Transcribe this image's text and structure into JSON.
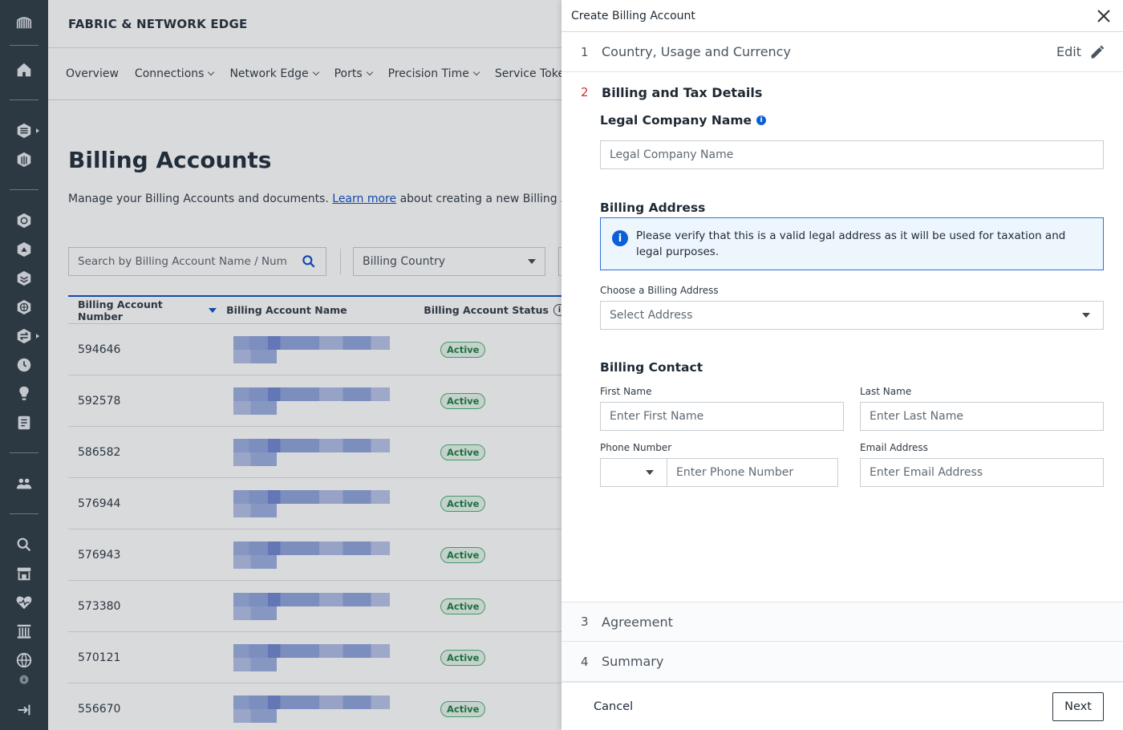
{
  "app": {
    "brand": "FABRIC & NETWORK EDGE"
  },
  "rail_icons": [
    "equinix-logo-icon",
    "home-icon",
    "layers-icon",
    "cube-icon",
    "network-icon",
    "share-icon",
    "stack-icon",
    "globe-icon",
    "exchange-icon",
    "clock-icon",
    "lightbulb-icon",
    "document-icon",
    "users-icon",
    "search-icon",
    "store-icon",
    "heartbeat-icon",
    "pillars-icon",
    "world-icon",
    "download-icon",
    "logout-icon"
  ],
  "nav": {
    "items": [
      {
        "label": "Overview",
        "has_menu": false
      },
      {
        "label": "Connections",
        "has_menu": true
      },
      {
        "label": "Network Edge",
        "has_menu": true
      },
      {
        "label": "Ports",
        "has_menu": true
      },
      {
        "label": "Precision Time",
        "has_menu": true
      },
      {
        "label": "Service Tokens",
        "has_menu": false
      }
    ]
  },
  "page": {
    "title": "Billing Accounts",
    "subtitle_before": "Manage your Billing Accounts and documents.",
    "subtitle_link": "Learn more",
    "subtitle_after": "about creating a new Billing Account.",
    "search_placeholder": "Search by Billing Account Name / Number",
    "country_filter": "Billing Country"
  },
  "table": {
    "columns": [
      "Billing Account Number",
      "Billing Account Name",
      "Billing Account Status"
    ],
    "rows": [
      {
        "number": "594646",
        "status": "Active"
      },
      {
        "number": "592578",
        "status": "Active"
      },
      {
        "number": "586582",
        "status": "Active"
      },
      {
        "number": "576944",
        "status": "Active"
      },
      {
        "number": "576943",
        "status": "Active"
      },
      {
        "number": "573380",
        "status": "Active"
      },
      {
        "number": "570121",
        "status": "Active"
      },
      {
        "number": "556670",
        "status": "Active"
      }
    ]
  },
  "drawer": {
    "title": "Create Billing Account",
    "steps": [
      {
        "num": "1",
        "label": "Country, Usage and Currency",
        "edit": "Edit"
      },
      {
        "num": "2",
        "label": "Billing and Tax Details"
      },
      {
        "num": "3",
        "label": "Agreement"
      },
      {
        "num": "4",
        "label": "Summary"
      }
    ],
    "legal_company": {
      "label": "Legal Company Name",
      "placeholder": "Legal Company Name"
    },
    "billing_address": {
      "heading": "Billing Address",
      "notice": "Please verify that this is a valid legal address as it will be used for taxation and legal purposes.",
      "choose_label": "Choose a Billing Address",
      "select_placeholder": "Select Address"
    },
    "billing_contact": {
      "heading": "Billing Contact",
      "first_name_label": "First Name",
      "first_name_placeholder": "Enter First Name",
      "last_name_label": "Last Name",
      "last_name_placeholder": "Enter Last Name",
      "phone_label": "Phone Number",
      "phone_placeholder": "Enter Phone Number",
      "email_label": "Email Address",
      "email_placeholder": "Enter Email Address"
    },
    "footer": {
      "cancel": "Cancel",
      "next": "Next"
    }
  },
  "colors": {
    "rail": "#2d3a44",
    "accent_blue": "#0b4fc4",
    "active_step": "#d32f2f",
    "status_green": "#1f7a44"
  }
}
